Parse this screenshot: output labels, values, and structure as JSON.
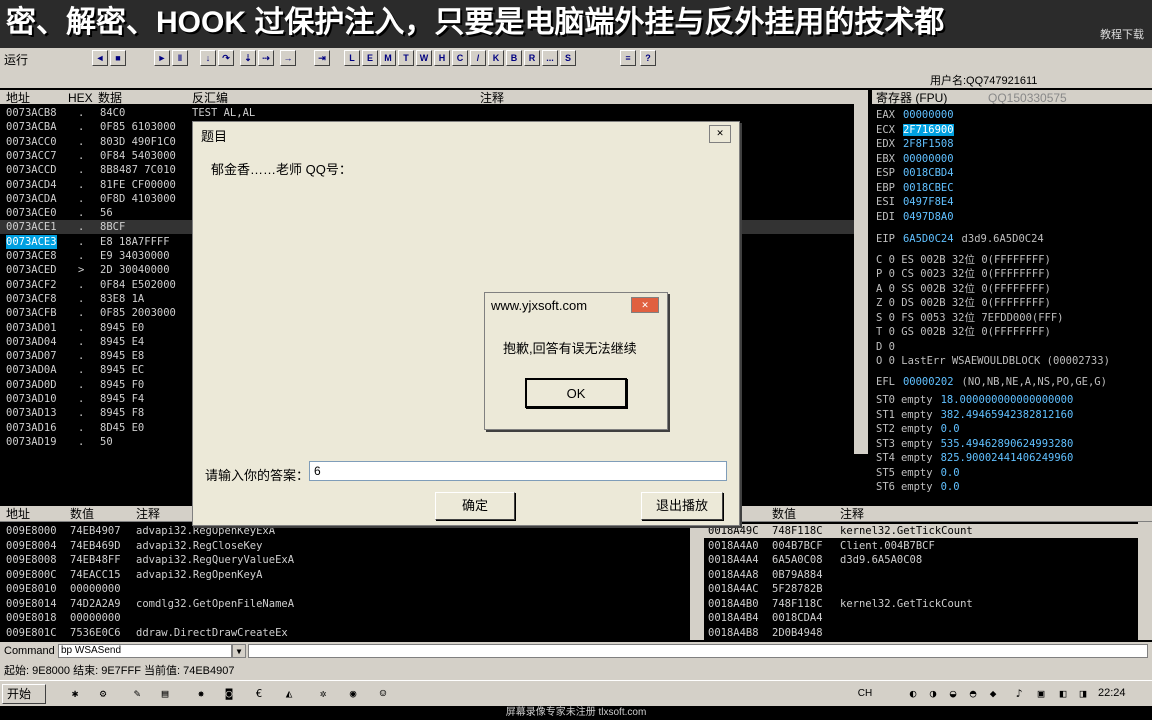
{
  "banner": {
    "text": "密、解密、HOOK 过保护注入，只要是电脑端外挂与反外挂用的技术都",
    "sub": "教程下载"
  },
  "toolbar": {
    "run_label": "运行",
    "buttons": [
      "L",
      "E",
      "M",
      "T",
      "W",
      "H",
      "C",
      "/",
      "K",
      "B",
      "R",
      "...",
      "S"
    ]
  },
  "user": {
    "name": "用户名:QQ747921611"
  },
  "disasm": {
    "headers": {
      "addr": "地址",
      "hex": "HEX",
      "data": "数据",
      "asm": "反汇编",
      "comment": "注释"
    },
    "rows": [
      {
        "addr": "0073ACB8",
        "m": ".",
        "hex": "84C0",
        "asm": "TEST AL,AL"
      },
      {
        "addr": "0073ACBA",
        "m": ".",
        "hex": "0F85 6103000",
        "asm": ""
      },
      {
        "addr": "0073ACC0",
        "m": ".",
        "hex": "803D 490F1C0",
        "asm": ""
      },
      {
        "addr": "0073ACC7",
        "m": ".",
        "hex": "0F84 5403000",
        "asm": ""
      },
      {
        "addr": "0073ACCD",
        "m": ".",
        "hex": "8B8487 7C010",
        "asm": ""
      },
      {
        "addr": "0073ACD4",
        "m": ".",
        "hex": "81FE CF00000",
        "asm": ""
      },
      {
        "addr": "0073ACDA",
        "m": ".",
        "hex": "0F8D 4103000",
        "asm": ""
      },
      {
        "addr": "0073ACE0",
        "m": ".",
        "hex": "56",
        "asm": ""
      },
      {
        "addr": "0073ACE1",
        "m": ".",
        "hex": "8BCF",
        "asm": ""
      },
      {
        "addr": "0073ACE3",
        "m": ".",
        "hex": "E8 18A7FFFF",
        "asm": ""
      },
      {
        "addr": "0073ACE8",
        "m": ".",
        "hex": "E9 34030000",
        "asm": ""
      },
      {
        "addr": "0073ACED",
        "m": ">",
        "hex": "2D 30040000",
        "asm": ""
      },
      {
        "addr": "0073ACF2",
        "m": ".",
        "hex": "0F84 E502000",
        "asm": ""
      },
      {
        "addr": "0073ACF8",
        "m": ".",
        "hex": "83E8 1A",
        "asm": ""
      },
      {
        "addr": "0073ACFB",
        "m": ".",
        "hex": "0F85 2003000",
        "asm": ""
      },
      {
        "addr": "0073AD01",
        "m": ".",
        "hex": "8945 E0",
        "asm": ""
      },
      {
        "addr": "0073AD04",
        "m": ".",
        "hex": "8945 E4",
        "asm": ""
      },
      {
        "addr": "0073AD07",
        "m": ".",
        "hex": "8945 E8",
        "asm": ""
      },
      {
        "addr": "0073AD0A",
        "m": ".",
        "hex": "8945 EC",
        "asm": ""
      },
      {
        "addr": "0073AD0D",
        "m": ".",
        "hex": "8945 F0",
        "asm": ""
      },
      {
        "addr": "0073AD10",
        "m": ".",
        "hex": "8945 F4",
        "asm": ""
      },
      {
        "addr": "0073AD13",
        "m": ".",
        "hex": "8945 F8",
        "asm": ""
      },
      {
        "addr": "0073AD16",
        "m": ".",
        "hex": "8D45 E0",
        "asm": ""
      },
      {
        "addr": "0073AD19",
        "m": ".",
        "hex": "50",
        "asm": ""
      }
    ]
  },
  "registers": {
    "header": "寄存器 (FPU)",
    "watermark": "QQ150330575",
    "gp": [
      {
        "name": "EAX",
        "val": "00000000"
      },
      {
        "name": "ECX",
        "val": "2F716900",
        "hl": true
      },
      {
        "name": "EDX",
        "val": "2F8F1508"
      },
      {
        "name": "EBX",
        "val": "00000000"
      },
      {
        "name": "ESP",
        "val": "0018CBD4"
      },
      {
        "name": "EBP",
        "val": "0018CBEC"
      },
      {
        "name": "ESI",
        "val": "0497F8E4"
      },
      {
        "name": "EDI",
        "val": "0497D8A0"
      }
    ],
    "eip": {
      "name": "EIP",
      "val": "6A5D0C24",
      "extra": "d3d9.6A5D0C24"
    },
    "flags": [
      "C 0  ES 002B 32位 0(FFFFFFFF)",
      "P 0  CS 0023 32位 0(FFFFFFFF)",
      "A 0  SS 002B 32位 0(FFFFFFFF)",
      "Z 0  DS 002B 32位 0(FFFFFFFF)",
      "S 0  FS 0053 32位 7EFDD000(FFF)",
      "T 0  GS 002B 32位 0(FFFFFFFF)",
      "D 0",
      "O 0  LastErr WSAEWOULDBLOCK (00002733)"
    ],
    "efl": {
      "name": "EFL",
      "val": "00000202",
      "extra": "(NO,NB,NE,A,NS,PO,GE,G)"
    },
    "fpu": [
      {
        "name": "ST0",
        "state": "empty",
        "val": "18.000000000000000000"
      },
      {
        "name": "ST1",
        "state": "empty",
        "val": "382.49465942382812160"
      },
      {
        "name": "ST2",
        "state": "empty",
        "val": "0.0"
      },
      {
        "name": "ST3",
        "state": "empty",
        "val": "535.49462890624993280"
      },
      {
        "name": "ST4",
        "state": "empty",
        "val": "825.90002441406249960"
      },
      {
        "name": "ST5",
        "state": "empty",
        "val": "0.0"
      },
      {
        "name": "ST6",
        "state": "empty",
        "val": "0.0"
      }
    ]
  },
  "dump": {
    "headers": {
      "addr": "地址",
      "val": "数值",
      "comment": "注释"
    },
    "rows": [
      {
        "addr": "009E8000",
        "val": "74EB4907",
        "comment": "advapi32.RegOpenKeyExA"
      },
      {
        "addr": "009E8004",
        "val": "74EB469D",
        "comment": "advapi32.RegCloseKey"
      },
      {
        "addr": "009E8008",
        "val": "74EB48FF",
        "comment": "advapi32.RegQueryValueExA"
      },
      {
        "addr": "009E800C",
        "val": "74EACC15",
        "comment": "advapi32.RegOpenKeyA"
      },
      {
        "addr": "009E8010",
        "val": "00000000",
        "comment": ""
      },
      {
        "addr": "009E8014",
        "val": "74D2A2A9",
        "comment": "comdlg32.GetOpenFileNameA"
      },
      {
        "addr": "009E8018",
        "val": "00000000",
        "comment": ""
      },
      {
        "addr": "009E801C",
        "val": "7536E0C6",
        "comment": "ddraw.DirectDrawCreateEx"
      }
    ]
  },
  "stack": {
    "headers": {
      "val": "数值",
      "comment": "注释"
    },
    "rows": [
      {
        "addr": "0018A49C",
        "val": "748F118C",
        "comment": "kernel32.GetTickCount",
        "sel": true
      },
      {
        "addr": "0018A4A0",
        "val": "004B7BCF",
        "comment": "Client.004B7BCF"
      },
      {
        "addr": "0018A4A4",
        "val": "6A5A0C08",
        "comment": "d3d9.6A5A0C08"
      },
      {
        "addr": "0018A4A8",
        "val": "0B79A884",
        "comment": ""
      },
      {
        "addr": "0018A4AC",
        "val": "5F28782B",
        "comment": ""
      },
      {
        "addr": "0018A4B0",
        "val": "748F118C",
        "comment": "kernel32.GetTickCount"
      },
      {
        "addr": "0018A4B4",
        "val": "0018CDA4",
        "comment": ""
      },
      {
        "addr": "0018A4B8",
        "val": "2D0B4948",
        "comment": ""
      }
    ]
  },
  "command": {
    "label": "Command :",
    "value": "bp WSASend"
  },
  "status": {
    "text": "起始: 9E8000  结束: 9E7FFF  当前值: 74EB4907"
  },
  "taskbar": {
    "start": "开始",
    "clock": "22:24",
    "lang": "CH"
  },
  "footer": {
    "text": "屏幕录像专家未注册 tlxsoft.com"
  },
  "dialog1": {
    "title": "题目",
    "prompt": "郁金香……老师 QQ号：",
    "answer_label": "请输入你的答案：",
    "answer_value": "6",
    "ok": "确定",
    "exit": "退出播放"
  },
  "dialog2": {
    "title": "www.yjxsoft.com",
    "message": "抱歉,回答有误无法继续",
    "ok": "OK"
  }
}
